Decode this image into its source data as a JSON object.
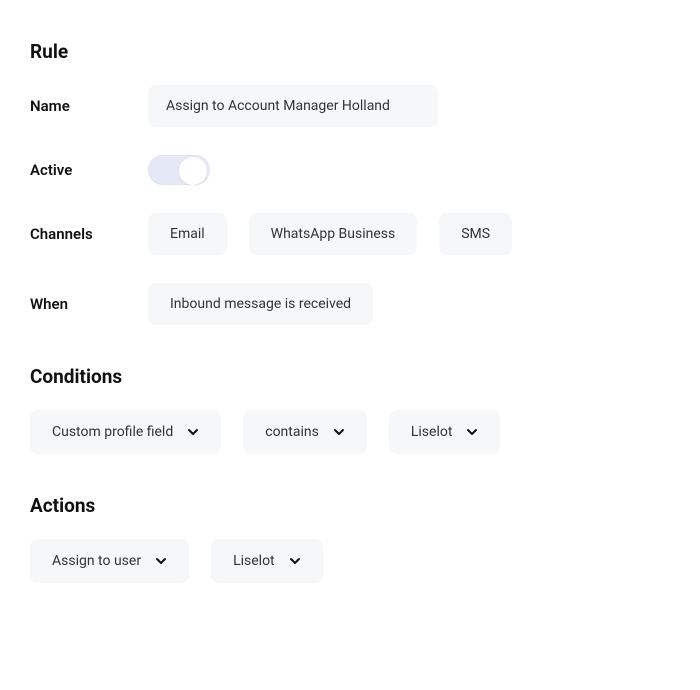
{
  "rule": {
    "section_title": "Rule",
    "name": {
      "label": "Name",
      "value": "Assign to Account Manager Holland"
    },
    "active": {
      "label": "Active",
      "value": true
    },
    "channels": {
      "label": "Channels",
      "items": [
        "Email",
        "WhatsApp Business",
        "SMS"
      ]
    },
    "when": {
      "label": "When",
      "value": "Inbound message is received"
    }
  },
  "conditions": {
    "section_title": "Conditions",
    "field": "Custom profile field",
    "operator": "contains",
    "value": "Liselot"
  },
  "actions": {
    "section_title": "Actions",
    "action": "Assign to user",
    "target": "Liselot"
  }
}
